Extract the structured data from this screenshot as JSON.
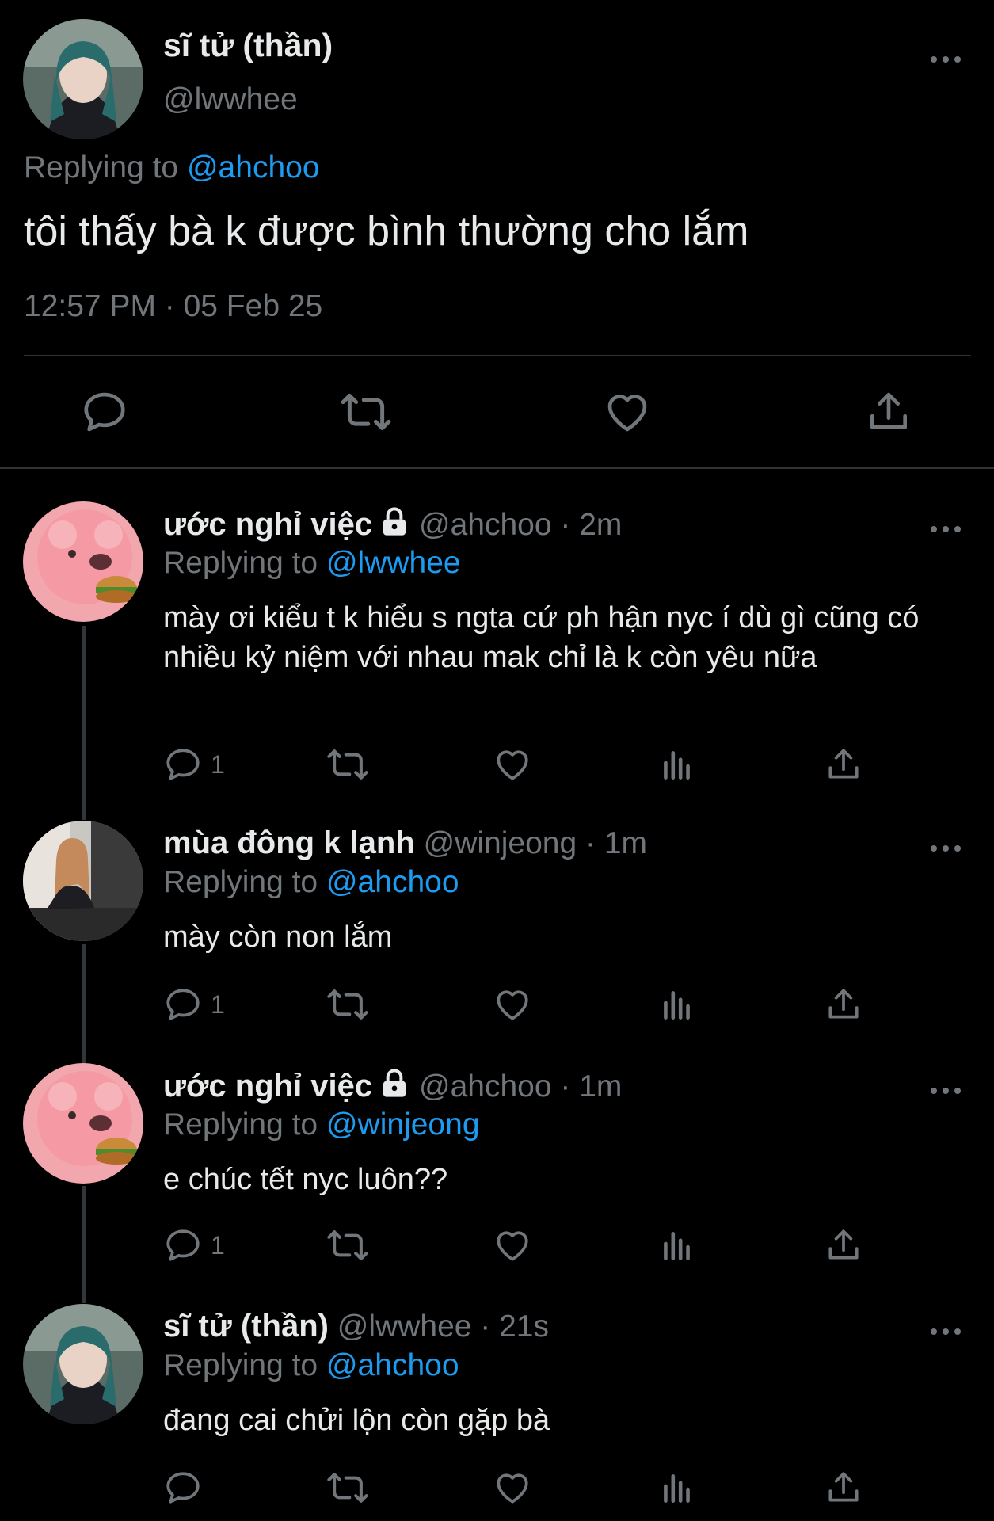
{
  "main_tweet": {
    "name": "sĩ tử (thần)",
    "handle": "@lwwhee",
    "replying_label": "Replying to",
    "replying_to": "@ahchoo",
    "text": "tôi thấy bà k được bình thường cho lắm",
    "timestamp": "12:57 PM · 05 Feb 25",
    "actions": [
      "reply-icon",
      "retweet-icon",
      "like-icon",
      "share-icon"
    ]
  },
  "replies": [
    {
      "name": "ước nghỉ việc",
      "locked": true,
      "handle": "@ahchoo",
      "time": "· 2m",
      "replying_label": "Replying to",
      "replying_to": "@lwwhee",
      "text": "mày ơi kiểu t k hiểu s ngta cứ ph hận nyc í dù gì cũng có nhiều kỷ niệm với nhau mak chỉ là k còn yêu nữa",
      "reply_count": "1"
    },
    {
      "name": "mùa đông k lạnh",
      "locked": false,
      "handle": "@winjeong",
      "time": "· 1m",
      "replying_label": "Replying to",
      "replying_to": "@ahchoo",
      "text": "mày còn non lắm",
      "reply_count": "1"
    },
    {
      "name": "ước nghỉ việc",
      "locked": true,
      "handle": "@ahchoo",
      "time": "· 1m",
      "replying_label": "Replying to",
      "replying_to": "@winjeong",
      "text": "e chúc tết nyc luôn??",
      "reply_count": "1"
    },
    {
      "name": "sĩ tử (thần)",
      "locked": false,
      "handle": "@lwwhee",
      "time": "· 21s",
      "replying_label": "Replying to",
      "replying_to": "@ahchoo",
      "text": "đang cai chửi lộn còn gặp bà",
      "reply_count": ""
    }
  ],
  "colors": {
    "background": "#000000",
    "text": "#e7e9ea",
    "muted": "#71767b",
    "link": "#1d9bf0",
    "divider": "#2f3336"
  }
}
